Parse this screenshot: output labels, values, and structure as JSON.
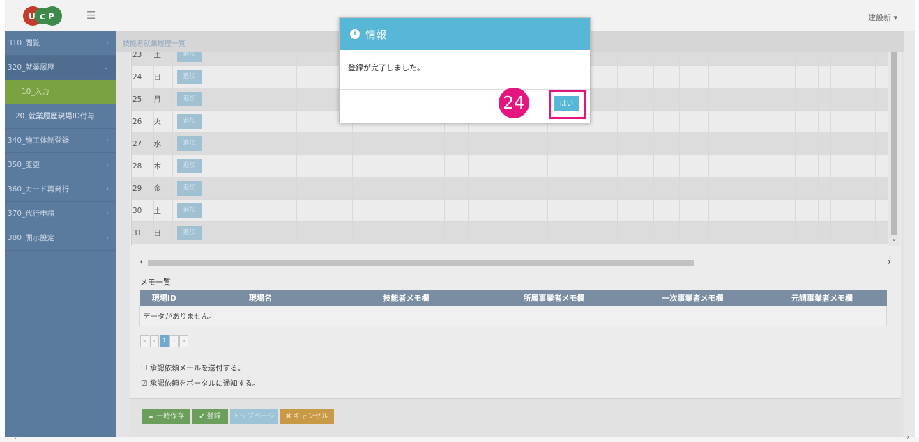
{
  "header": {
    "user_label": "建設新 ▾"
  },
  "sidebar": {
    "items": [
      {
        "label": "310_閲覧",
        "arrow": "‹"
      },
      {
        "label": "320_就業履歴",
        "arrow": "⌄"
      },
      {
        "label": "10_入力"
      },
      {
        "label": "20_就業履歴現場ID付与"
      },
      {
        "label": "340_施工体制登録",
        "arrow": "‹"
      },
      {
        "label": "350_変更",
        "arrow": "‹"
      },
      {
        "label": "360_カード再発行",
        "arrow": "‹"
      },
      {
        "label": "370_代行申請",
        "arrow": "‹"
      },
      {
        "label": "380_開示設定",
        "arrow": "‹"
      }
    ]
  },
  "breadcrumb": "技能者就業履歴一覧",
  "calendar": {
    "add_label": "追加",
    "rows": [
      {
        "day": "23",
        "weekday": "土"
      },
      {
        "day": "24",
        "weekday": "日"
      },
      {
        "day": "25",
        "weekday": "月"
      },
      {
        "day": "26",
        "weekday": "火"
      },
      {
        "day": "27",
        "weekday": "水"
      },
      {
        "day": "28",
        "weekday": "木"
      },
      {
        "day": "29",
        "weekday": "金"
      },
      {
        "day": "30",
        "weekday": "土"
      },
      {
        "day": "31",
        "weekday": "日"
      }
    ]
  },
  "memo": {
    "title": "メモ一覧",
    "columns": [
      "現場ID",
      "現場名",
      "技能者メモ欄",
      "所属事業者メモ欄",
      "一次事業者メモ欄",
      "元請事業者メモ欄"
    ],
    "empty": "データがありません。"
  },
  "pager": {
    "first": "«",
    "prev": "‹",
    "current": "1",
    "next": "›",
    "last": "»"
  },
  "options": {
    "mail": "☐ 承認依頼メールを送付する。",
    "portal": "☑ 承認依頼をポータルに通知する。"
  },
  "buttons": {
    "temp_save": "☁ 一時保存",
    "register": "✔ 登録",
    "top": "トップページへ",
    "cancel": "✖ キャンセル"
  },
  "modal": {
    "icon": "i",
    "title": "情報",
    "message": "登録が完了しました。",
    "step_number": "24",
    "ok_label": "はい"
  }
}
